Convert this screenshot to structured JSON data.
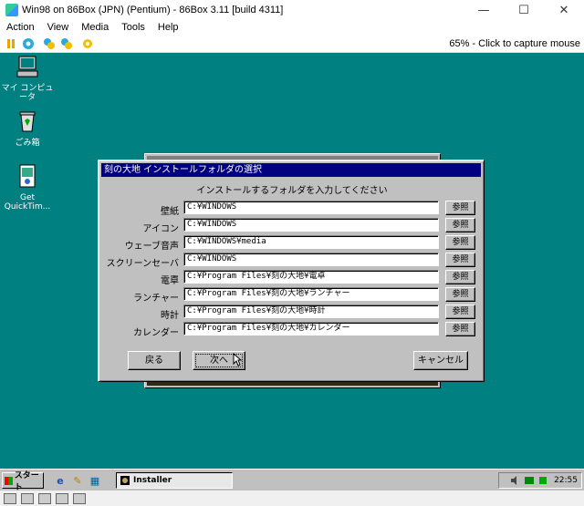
{
  "host": {
    "title": "Win98 on 86Box (JPN) (Pentium) - 86Box 3.11 [build 4311]",
    "window_buttons": [
      "—",
      "☐",
      "✕"
    ],
    "menu": [
      "Action",
      "View",
      "Media",
      "Tools",
      "Help"
    ],
    "status_text": "65% - Click to capture mouse"
  },
  "desktop": {
    "icons": [
      {
        "label": "マイ コンピュータ",
        "icon": "computer-icon"
      },
      {
        "label": "ごみ箱",
        "icon": "recycle-bin-icon"
      },
      {
        "label": "Get QuickTim...",
        "icon": "quicktime-icon"
      }
    ]
  },
  "dialog": {
    "title": "刻の大地 インストールフォルダの選択",
    "prompt": "インストールするフォルダを入力してください",
    "rows": [
      {
        "label": "壁紙",
        "value": "C:¥WINDOWS",
        "browse": "参照"
      },
      {
        "label": "アイコン",
        "value": "C:¥WINDOWS",
        "browse": "参照"
      },
      {
        "label": "ウェーブ音声",
        "value": "C:¥WINDOWS¥media",
        "browse": "参照"
      },
      {
        "label": "スクリーンセーバー",
        "value": "C:¥WINDOWS",
        "browse": "参照"
      },
      {
        "label": "電卓",
        "value": "C:¥Program Files¥刻の大地¥電卓",
        "browse": "参照"
      },
      {
        "label": "ランチャー",
        "value": "C:¥Program Files¥刻の大地¥ランチャー",
        "browse": "参照"
      },
      {
        "label": "時計",
        "value": "C:¥Program Files¥刻の大地¥時計",
        "browse": "参照"
      },
      {
        "label": "カレンダー",
        "value": "C:¥Program Files¥刻の大地¥カレンダー",
        "browse": "参照"
      }
    ],
    "back_label": "戻る",
    "next_label": "次へ",
    "cancel_label": "キャンセル"
  },
  "taskbar": {
    "start_label": "スタート",
    "task_label": "Installer",
    "clock": "22:55"
  }
}
